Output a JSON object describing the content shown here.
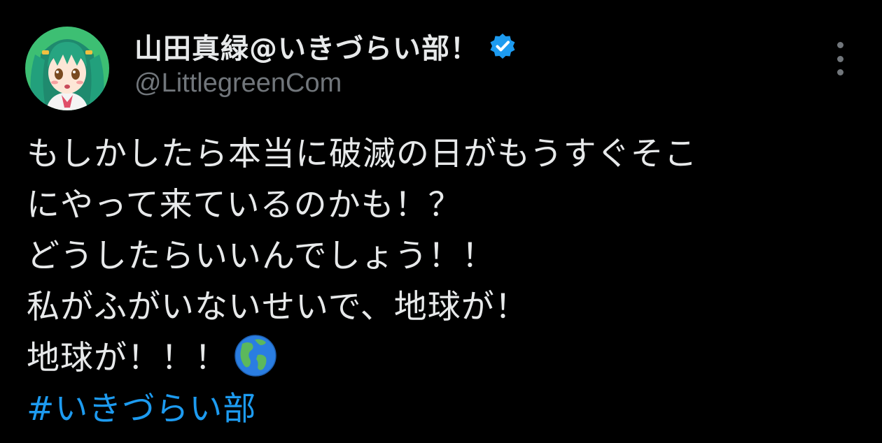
{
  "tweet": {
    "author": {
      "display_name": "山田真緑@いきづらい部！",
      "handle": "@LittlegreenCom",
      "verified": true,
      "avatar_icon": "anime-girl-green-hair-avatar"
    },
    "body_lines": [
      "もしかしたら本当に破滅の日がもうすぐそこ",
      "にやって来ているのかも！？",
      "どうしたらいいんでしょう！！",
      "私がふがいないせいで、地球が！",
      "地球が！！！"
    ],
    "emoji": "globe-americas-icon",
    "hashtag": "#いきづらい部"
  },
  "colors": {
    "background": "#000000",
    "text": "#e7e9ea",
    "secondary": "#71767b",
    "accent": "#1d9bf0",
    "avatar_bg": "#3dbf73"
  }
}
